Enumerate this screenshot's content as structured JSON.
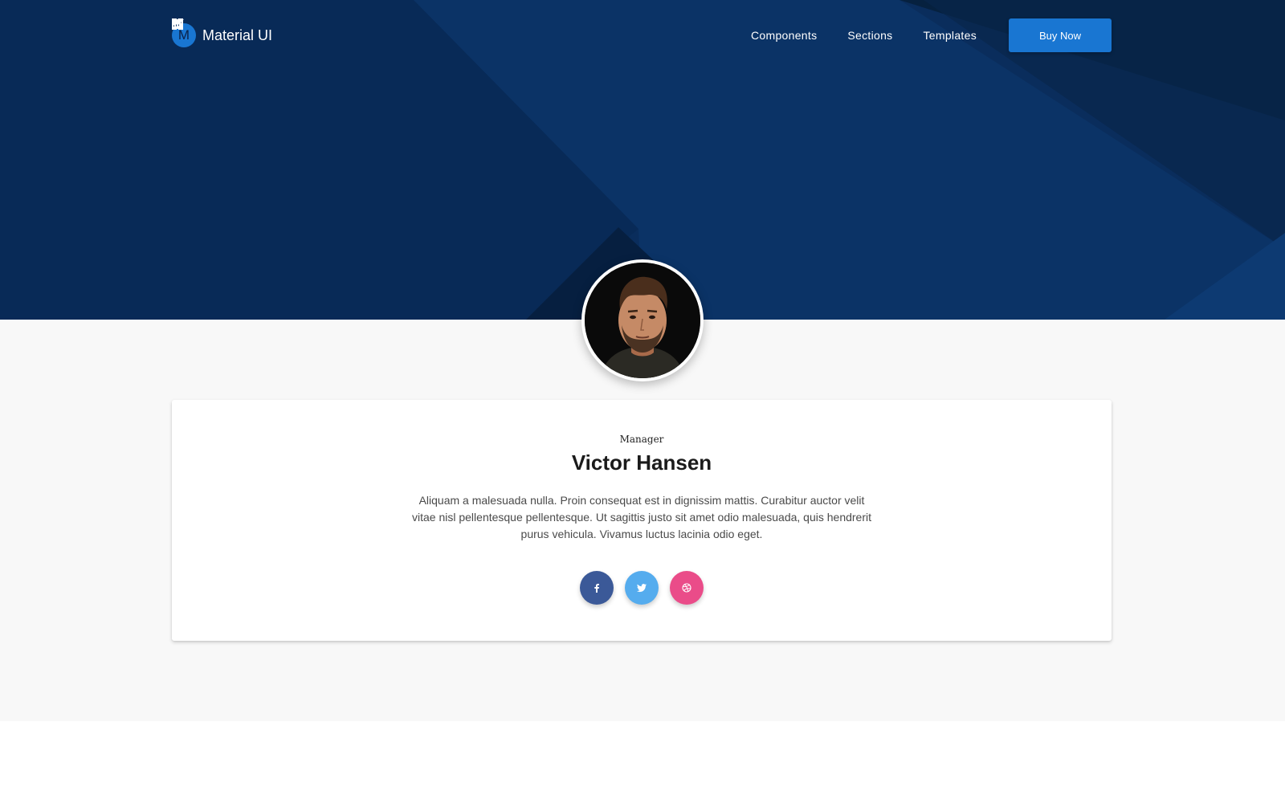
{
  "brand": {
    "logo_letter": "M",
    "name": "Material UI"
  },
  "nav": {
    "items": [
      {
        "label": "Components",
        "icon": "dashboard-icon"
      },
      {
        "label": "Sections",
        "icon": "list-icon"
      },
      {
        "label": "Templates",
        "icon": "view-columns-icon"
      }
    ],
    "buy_label": "Buy Now",
    "buy_icon": "cart-icon"
  },
  "profile": {
    "role": "Manager",
    "name": "Victor Hansen",
    "description": "Aliquam a malesuada nulla. Proin consequat est in dignissim mattis. Curabitur auctor velit vitae nisl pellentesque pellentesque. Ut sagittis justo sit amet odio malesuada, quis hendrerit purus vehicula. Vivamus luctus lacinia odio eget.",
    "social": [
      {
        "network": "facebook",
        "icon": "facebook-icon",
        "color": "#3b5998"
      },
      {
        "network": "twitter",
        "icon": "twitter-icon",
        "color": "#55acee"
      },
      {
        "network": "dribbble",
        "icon": "dribbble-icon",
        "color": "#ea4c89"
      }
    ]
  },
  "colors": {
    "hero_bg": "#0a2d5c",
    "accent": "#1976d2",
    "section_bg": "#f8f8f8"
  }
}
